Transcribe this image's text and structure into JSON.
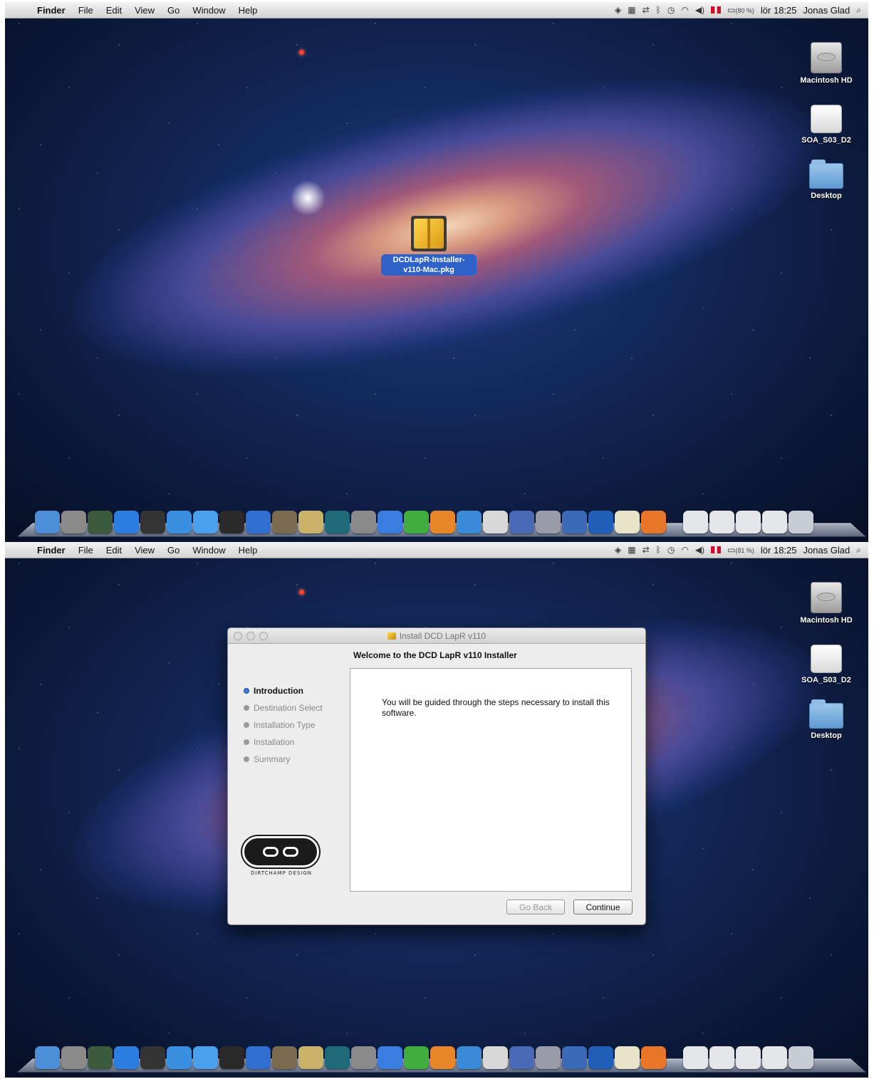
{
  "menubar_top": {
    "menus": [
      "Finder",
      "File",
      "Edit",
      "View",
      "Go",
      "Window",
      "Help"
    ],
    "battery": "(80 %)",
    "clock": "lör 18:25",
    "user": "Jonas Glad"
  },
  "menubar_bottom": {
    "menus": [
      "Finder",
      "File",
      "Edit",
      "View",
      "Go",
      "Window",
      "Help"
    ],
    "battery": "(81 %)",
    "clock": "lör 18:25",
    "user": "Jonas Glad"
  },
  "desktop_icons": [
    {
      "label": "Macintosh HD",
      "icon": "hard-drive-icon"
    },
    {
      "label": "SOA_S03_D2",
      "icon": "disk-icon"
    },
    {
      "label": "Desktop",
      "icon": "folder-icon"
    }
  ],
  "package": {
    "label": "DCDLapR-Installer-v110-Mac.pkg",
    "icon": "package-icon"
  },
  "installer": {
    "window_title": "Install DCD LapR v110",
    "heading": "Welcome to the DCD LapR v110 Installer",
    "steps": [
      "Introduction",
      "Destination Select",
      "Installation Type",
      "Installation",
      "Summary"
    ],
    "active_step": 0,
    "body_text": "You will be guided through the steps necessary to install this software.",
    "logo_text": "DIRTCHAMP DESIGN",
    "go_back_label": "Go Back",
    "continue_label": "Continue"
  },
  "dock_apps": [
    {
      "name": "finder",
      "color": "#4a8fd8"
    },
    {
      "name": "launchpad",
      "color": "#8a8a8a"
    },
    {
      "name": "mission-control",
      "color": "#3c5a3c"
    },
    {
      "name": "app-store",
      "color": "#2c7de0"
    },
    {
      "name": "dashboard",
      "color": "#333333"
    },
    {
      "name": "safari",
      "color": "#3a8fe0"
    },
    {
      "name": "ichat",
      "color": "#4aa0ea"
    },
    {
      "name": "facetime",
      "color": "#2a2a2a"
    },
    {
      "name": "itunes",
      "color": "#2f6fd0"
    },
    {
      "name": "iphoto",
      "color": "#7a6a50"
    },
    {
      "name": "imovie",
      "color": "#c9b26a"
    },
    {
      "name": "time-machine",
      "color": "#1e6a78"
    },
    {
      "name": "system-preferences",
      "color": "#8a8a8a"
    },
    {
      "name": "word",
      "color": "#3a7de0"
    },
    {
      "name": "excel",
      "color": "#3fae3f"
    },
    {
      "name": "powerpoint",
      "color": "#e8862a"
    },
    {
      "name": "messenger",
      "color": "#3a8ad8"
    },
    {
      "name": "calendar",
      "color": "#d8d8d8"
    },
    {
      "name": "keynote",
      "color": "#4a6ab8"
    },
    {
      "name": "script-editor",
      "color": "#9a9aa8"
    },
    {
      "name": "grapher",
      "color": "#3a6ab8"
    },
    {
      "name": "photoshop",
      "color": "#1f5fb8"
    },
    {
      "name": "textedit",
      "color": "#e8e2c8"
    },
    {
      "name": "firefox",
      "color": "#e8762a"
    }
  ],
  "dock_stacks": [
    "downloads-stack",
    "documents-stack",
    "applications-stack",
    "terminal-stack",
    "trash"
  ]
}
